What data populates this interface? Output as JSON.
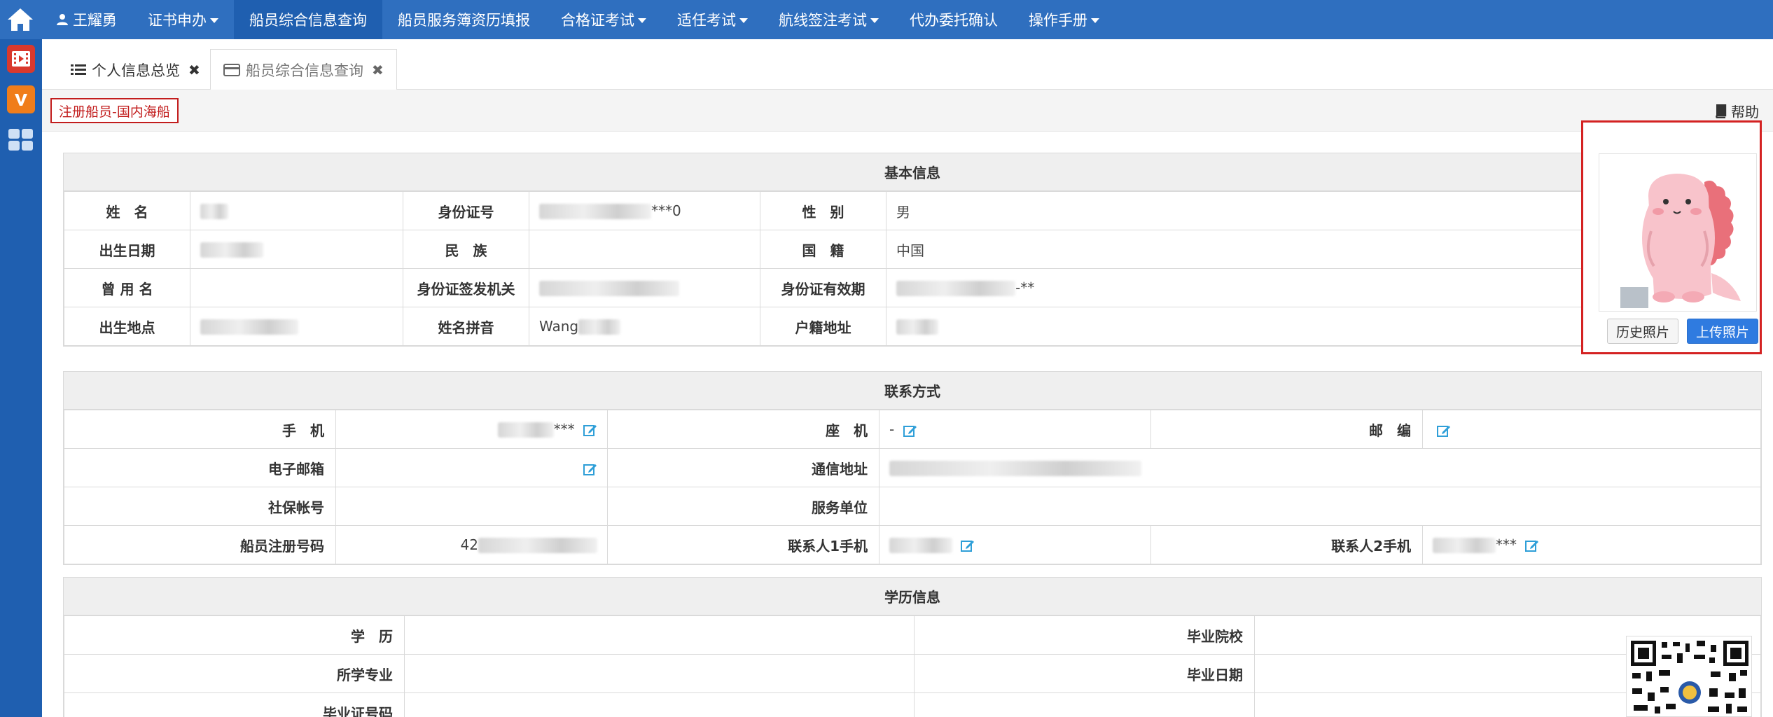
{
  "nav": {
    "user": "王耀勇",
    "items": [
      {
        "label": "证书申办",
        "dropdown": true
      },
      {
        "label": "船员综合信息查询",
        "dropdown": false,
        "active": true
      },
      {
        "label": "船员服务簿资历填报",
        "dropdown": false
      },
      {
        "label": "合格证考试",
        "dropdown": true
      },
      {
        "label": "适任考试",
        "dropdown": true
      },
      {
        "label": "航线签注考试",
        "dropdown": true
      },
      {
        "label": "代办委托确认",
        "dropdown": false
      },
      {
        "label": "操作手册",
        "dropdown": true
      }
    ]
  },
  "tabs": [
    {
      "label": "个人信息总览"
    },
    {
      "label": "船员综合信息查询"
    }
  ],
  "breadcrumb": {
    "label": "注册船员-国内海船",
    "help": "帮助"
  },
  "basic": {
    "title": "基本信息",
    "rows": [
      [
        {
          "label": "姓　名",
          "value": ""
        },
        {
          "label": "身份证号",
          "value": "***0"
        },
        {
          "label": "性　别",
          "value": "男"
        }
      ],
      [
        {
          "label": "出生日期",
          "value": ""
        },
        {
          "label": "民　族",
          "value": ""
        },
        {
          "label": "国　籍",
          "value": "中国"
        }
      ],
      [
        {
          "label": "曾 用 名",
          "value": ""
        },
        {
          "label": "身份证签发机关",
          "value": ""
        },
        {
          "label": "身份证有效期",
          "value": "-**"
        }
      ],
      [
        {
          "label": "出生地点",
          "value": ""
        },
        {
          "label": "姓名拼音",
          "value": "Wang"
        },
        {
          "label": "户籍地址",
          "value": ""
        }
      ]
    ]
  },
  "contact": {
    "title": "联系方式",
    "phone_label": "手　机",
    "phone_value": "***",
    "landline_label": "座　机",
    "landline_value": "-",
    "zip_label": "邮　编",
    "email_label": "电子邮箱",
    "address_label": "通信地址",
    "social_label": "社保帐号",
    "employer_label": "服务单位",
    "reg_label": "船员注册号码",
    "reg_value": "42",
    "c1_label": "联系人1手机",
    "c2_label": "联系人2手机",
    "c2_value": "***"
  },
  "education": {
    "title": "学历信息",
    "degree_label": "学　历",
    "school_label": "毕业院校",
    "major_label": "所学专业",
    "grad_date_label": "毕业日期",
    "cert_label": "毕业证号码"
  },
  "photo": {
    "history_button": "历史照片",
    "upload_button": "上传照片"
  },
  "colors": {
    "nav_bg": "#2f6fbf",
    "nav_active": "#1f5fb0",
    "highlight_red": "#d42222",
    "primary_button": "#2f7be0",
    "edit_icon": "#2f9fd8"
  }
}
